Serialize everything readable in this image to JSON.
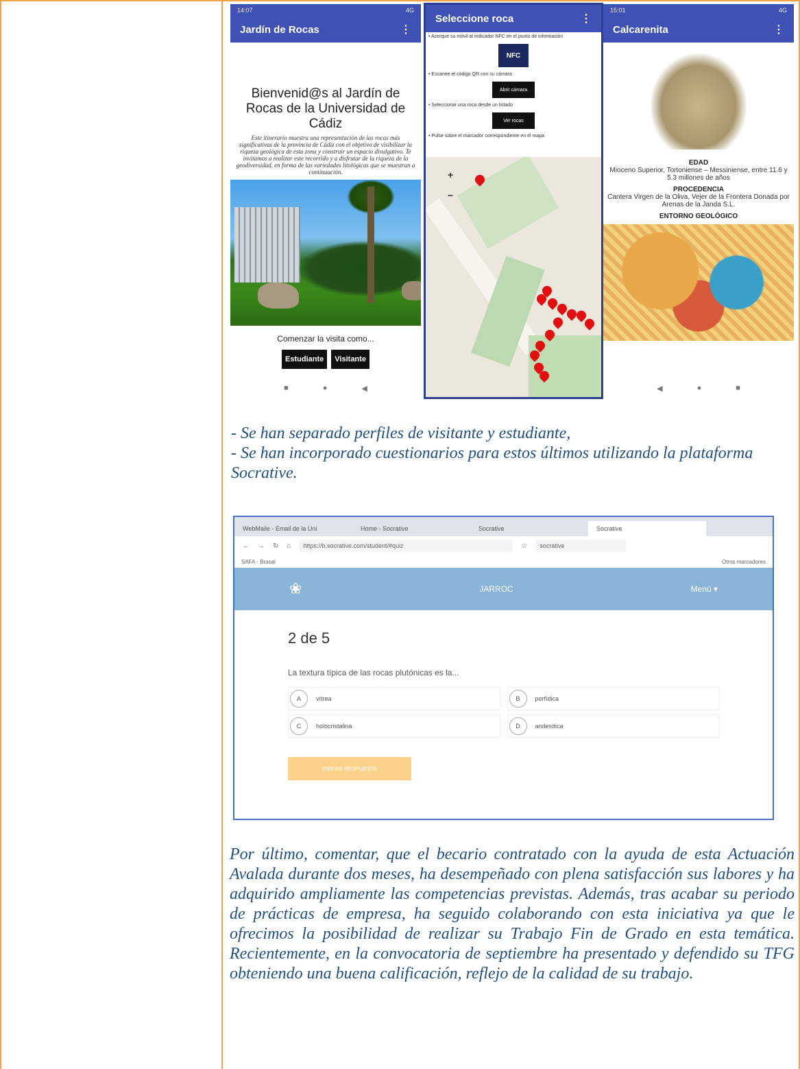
{
  "phone1": {
    "status_left": "14:07",
    "status_right": "4G",
    "appbar_title": "Jardín de Rocas",
    "welcome_title": "Bienvenid@s al Jardín de Rocas de la Universidad de Cádiz",
    "intro": "Este itinerario muestra una representación de las rocas más significativas de la provincia de Cádiz con el objetivo de visibilizar la riqueza geológica de esta zona y construir un espacio divulgativo. Te invitamos a realizar este recorrido y a disfrutar de la riqueza de la geodiversidad, en forma de las variedades litológicas que se muestran a continuación.",
    "start_text": "Comenzar la visita como...",
    "btn_student": "Estudiante",
    "btn_visitor": "Visitante"
  },
  "phone2": {
    "appbar_title": "Seleccione roca",
    "step1": "• Acerque su móvil al indicador NFC en el punto de información",
    "nfc_label": "NFC",
    "step2": "• Escanee el código QR con su cámara",
    "btn_camera": "Abrir cámara",
    "step3": "• Seleccionar una roca desde un listado",
    "btn_rocks": "Ver rocas",
    "step4": "• Pulse sobre el marcador correspondiente en el mapa",
    "zoom_in": "+",
    "zoom_out": "−"
  },
  "phone3": {
    "status_left": "15:01",
    "status_right": "4G",
    "appbar_title": "Calcarenita",
    "h_age": "EDAD",
    "age": "Mioceno Superior, Tortoniense – Messiniense, entre 11.6 y 5.3 millones de años",
    "h_origin": "PROCEDENCIA",
    "origin": "Cantera Virgen de la Oliva, Vejer de la Frontera Donada por Arenas de la Janda S.L.",
    "h_env": "ENTORNO GEOLÓGICO"
  },
  "bullets": [
    "- Se han separado perfiles de visitante y estudiante,",
    "- Se han incorporado cuestionarios para estos últimos utilizando la plataforma Socrative."
  ],
  "browser": {
    "tabs": [
      "WebMaile - Email de la Uni",
      "Home - Socrative",
      "Socrative",
      "Socrative"
    ],
    "url": "https://b.socrative.com/student/#quiz",
    "search": "socrative",
    "bookmark": "SAFA - Brasal",
    "bookmarks_right": "Otros marcadores"
  },
  "socrative": {
    "room": "JARROC",
    "menu": "Menú ▾",
    "question_num": "2 de 5",
    "question": "La textura típica de las rocas plutónicas es la...",
    "options": [
      {
        "letter": "A",
        "text": "vítrea"
      },
      {
        "letter": "B",
        "text": "porfídica"
      },
      {
        "letter": "C",
        "text": "holocristalina"
      },
      {
        "letter": "D",
        "text": "andesítica"
      }
    ],
    "send": "ENVIAR RESPUESTA"
  },
  "paragraph": "Por último, comentar, que el becario contratado con la ayuda de esta Actuación Avalada durante dos meses, ha desempeñado con plena satisfacción sus labores y ha adquirido ampliamente las competencias previstas. Además, tras acabar su periodo de prácticas de empresa, ha seguido colaborando con esta iniciativa ya que le ofrecimos la posibilidad de realizar su Trabajo Fin de Grado en esta temática. Recientemente, en la convocatoria de septiembre ha presentado y defendido su TFG obteniendo una buena calificación, reflejo de la calidad de su trabajo."
}
